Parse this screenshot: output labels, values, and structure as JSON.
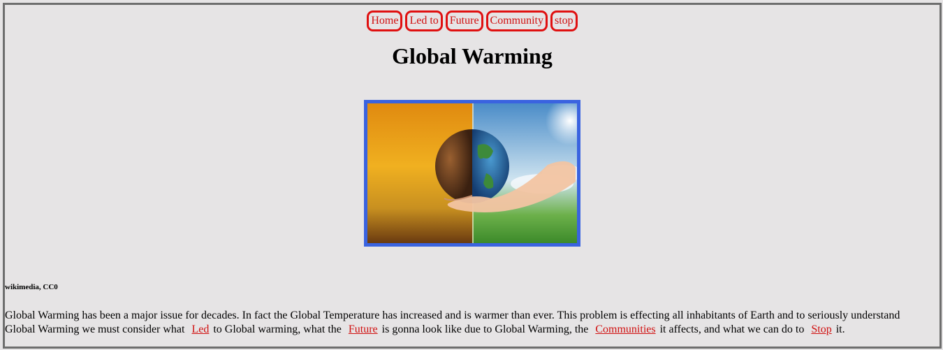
{
  "nav": {
    "items": [
      {
        "label": "Home"
      },
      {
        "label": "Led to"
      },
      {
        "label": "Future"
      },
      {
        "label": "Community"
      },
      {
        "label": "stop"
      }
    ]
  },
  "page": {
    "title": "Global Warming",
    "image_credit": "wikimedia, CC0"
  },
  "article": {
    "text_1": "Global Warming has been a major issue for decades. In fact the Global Temperature has increased and is warmer than ever. This problem is effecting all inhabitants of Earth and to seriously understand Global Warming we must consider what",
    "link_led": "Led",
    "text_2": "to Global warming, what the",
    "link_future": "Future",
    "text_3": "is gonna look like due to Global Warming, the",
    "link_communities": "Communities",
    "text_4": "it affects, and what we can do to",
    "link_stop": "Stop",
    "text_5": "it."
  },
  "colors": {
    "background": "#e6e4e5",
    "nav_border": "#e01010",
    "link": "#d01010",
    "image_border": "#3a63e0",
    "frame_border": "#6e6e6e"
  }
}
